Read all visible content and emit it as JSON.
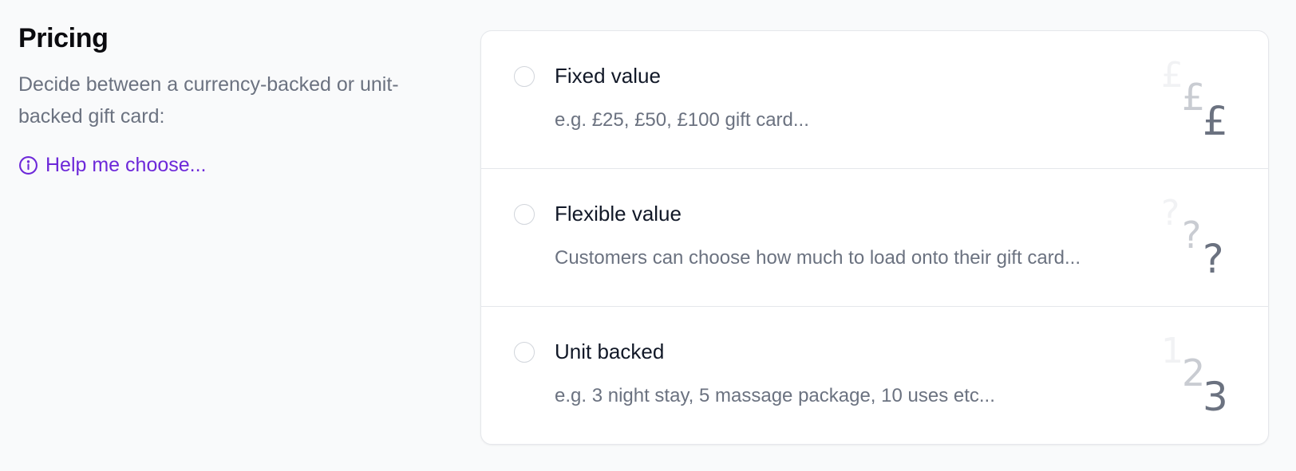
{
  "section": {
    "title": "Pricing",
    "description": "Decide between a currency-backed or unit-backed gift card:",
    "help_link": "Help me choose..."
  },
  "options": [
    {
      "title": "Fixed value",
      "description": "e.g. £25, £50, £100 gift card...",
      "glyphs": [
        "£",
        "£",
        "£"
      ],
      "selected": false
    },
    {
      "title": "Flexible value",
      "description": "Customers can choose how much to load onto their gift card...",
      "glyphs": [
        "?",
        "?",
        "?"
      ],
      "selected": false
    },
    {
      "title": "Unit backed",
      "description": "e.g. 3 night stay, 5 massage package, 10 uses etc...",
      "glyphs": [
        "1",
        "2",
        "3"
      ],
      "selected": false
    }
  ],
  "colors": {
    "accent": "#6d28d9",
    "muted_text": "#6b7280",
    "background": "#f9fafb"
  }
}
